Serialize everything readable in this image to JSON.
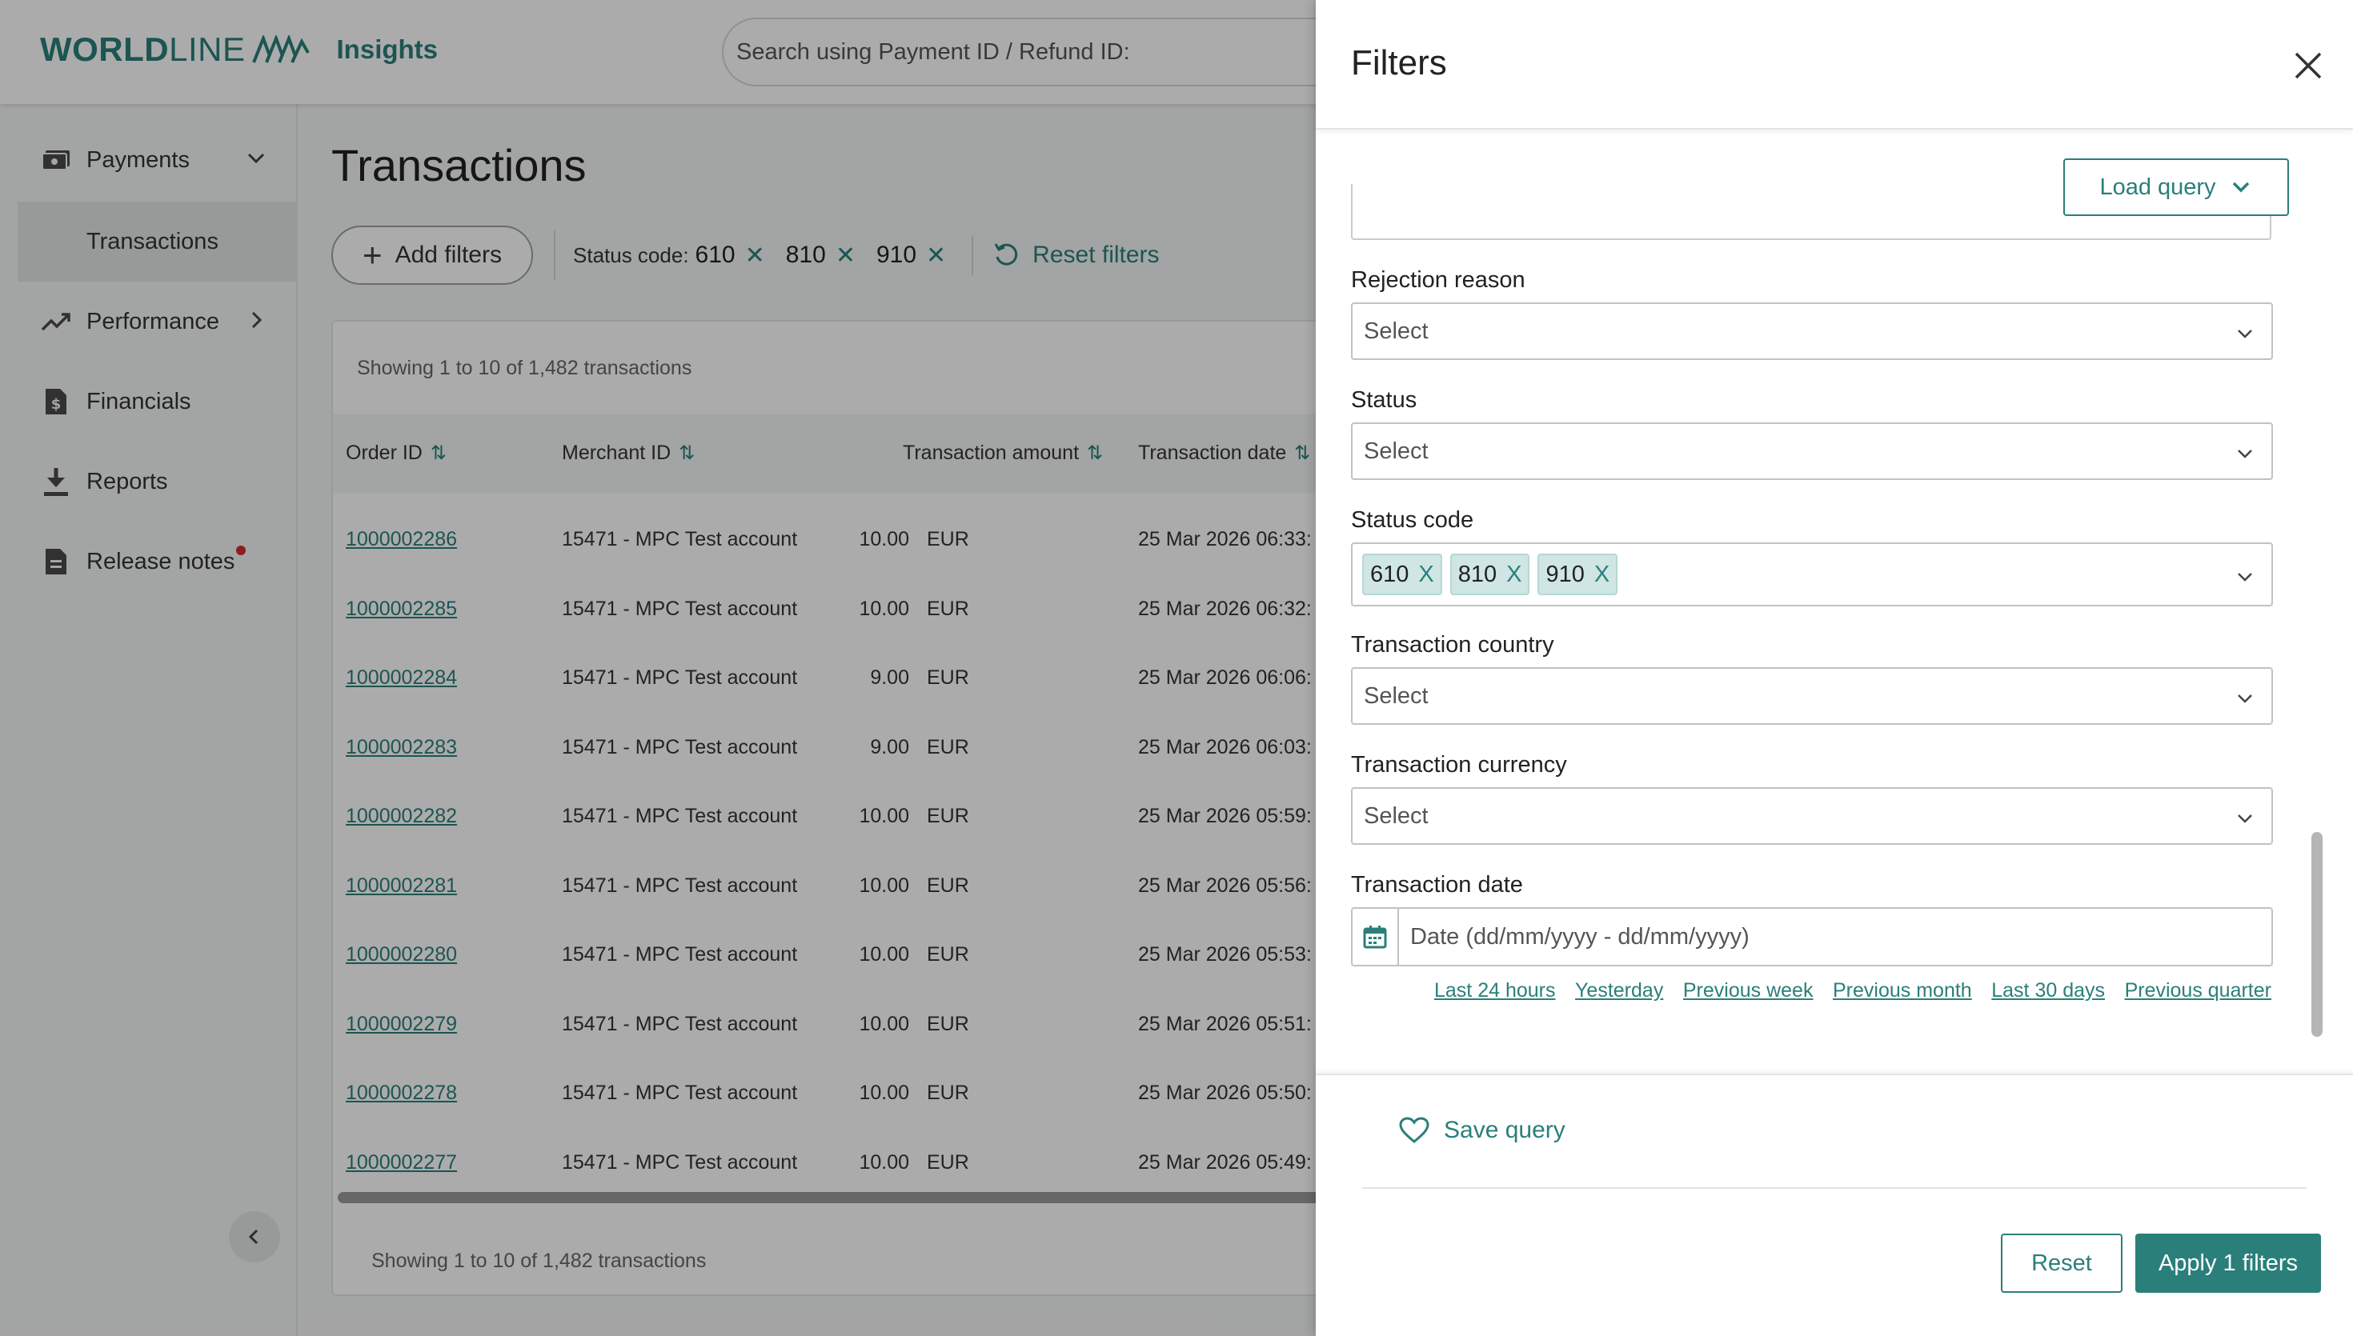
{
  "header": {
    "brand_bold": "WORLD",
    "brand_light": "LINE",
    "product": "Insights",
    "search_placeholder": "Search using Payment ID / Refund ID:"
  },
  "sidebar": {
    "items": [
      {
        "label": "Payments",
        "icon": "payments-icon"
      },
      {
        "label": "Transactions"
      },
      {
        "label": "Performance",
        "icon": "trend-up-icon"
      },
      {
        "label": "Financials",
        "icon": "document-dollar-icon"
      },
      {
        "label": "Reports",
        "icon": "download-icon"
      },
      {
        "label": "Release notes",
        "icon": "document-icon"
      }
    ]
  },
  "main": {
    "title": "Transactions",
    "add_filters_label": "Add filters",
    "active_filter": {
      "label": "Status code:",
      "values": [
        "610",
        "810",
        "910"
      ]
    },
    "reset_filters_label": "Reset filters",
    "showing_text": "Showing 1 to 10 of 1,482 transactions",
    "columns": [
      "Order ID",
      "Merchant ID",
      "Transaction amount",
      "Transaction date"
    ],
    "rows": [
      {
        "order_id": "1000002286",
        "merchant": "15471 - MPC Test account",
        "amount": "10.00",
        "currency": "EUR",
        "date": "25 Mar 2026 06:33:"
      },
      {
        "order_id": "1000002285",
        "merchant": "15471 - MPC Test account",
        "amount": "10.00",
        "currency": "EUR",
        "date": "25 Mar 2026 06:32:"
      },
      {
        "order_id": "1000002284",
        "merchant": "15471 - MPC Test account",
        "amount": "9.00",
        "currency": "EUR",
        "date": "25 Mar 2026 06:06:"
      },
      {
        "order_id": "1000002283",
        "merchant": "15471 - MPC Test account",
        "amount": "9.00",
        "currency": "EUR",
        "date": "25 Mar 2026 06:03:"
      },
      {
        "order_id": "1000002282",
        "merchant": "15471 - MPC Test account",
        "amount": "10.00",
        "currency": "EUR",
        "date": "25 Mar 2026 05:59:"
      },
      {
        "order_id": "1000002281",
        "merchant": "15471 - MPC Test account",
        "amount": "10.00",
        "currency": "EUR",
        "date": "25 Mar 2026 05:56:"
      },
      {
        "order_id": "1000002280",
        "merchant": "15471 - MPC Test account",
        "amount": "10.00",
        "currency": "EUR",
        "date": "25 Mar 2026 05:53:"
      },
      {
        "order_id": "1000002279",
        "merchant": "15471 - MPC Test account",
        "amount": "10.00",
        "currency": "EUR",
        "date": "25 Mar 2026 05:51:"
      },
      {
        "order_id": "1000002278",
        "merchant": "15471 - MPC Test account",
        "amount": "10.00",
        "currency": "EUR",
        "date": "25 Mar 2026 05:50:"
      },
      {
        "order_id": "1000002277",
        "merchant": "15471 - MPC Test account",
        "amount": "10.00",
        "currency": "EUR",
        "date": "25 Mar 2026 05:49:"
      }
    ]
  },
  "drawer": {
    "title": "Filters",
    "load_query_label": "Load query",
    "fields": {
      "rejection_reason": {
        "label": "Rejection reason",
        "value": "Select"
      },
      "status": {
        "label": "Status",
        "value": "Select"
      },
      "status_code": {
        "label": "Status code",
        "tags": [
          "610",
          "810",
          "910"
        ],
        "tag_remove": "X"
      },
      "transaction_country": {
        "label": "Transaction country",
        "value": "Select"
      },
      "transaction_currency": {
        "label": "Transaction currency",
        "value": "Select"
      },
      "transaction_date": {
        "label": "Transaction date",
        "placeholder": "Date (dd/mm/yyyy - dd/mm/yyyy)"
      }
    },
    "quick_ranges": [
      "Last 24 hours",
      "Yesterday",
      "Previous week",
      "Previous month",
      "Last 30 days",
      "Previous quarter"
    ],
    "save_query_label": "Save query",
    "reset_label": "Reset",
    "apply_label": "Apply 1 filters"
  },
  "colors": {
    "brand": "#2a7f7a",
    "notification": "#d62a2a",
    "tag_bg": "#cfe6e4"
  }
}
